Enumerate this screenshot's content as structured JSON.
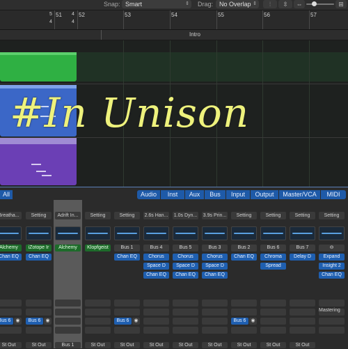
{
  "toolbar": {
    "snap_label": "Snap:",
    "snap_value": "Smart",
    "drag_label": "Drag:",
    "drag_value": "No Overlap"
  },
  "ruler": {
    "bars": [
      "51",
      "52",
      "53",
      "54",
      "55",
      "56",
      "57"
    ],
    "sig_top_a": "5",
    "sig_bottom_a": "4",
    "sig_top_b": "4",
    "sig_bottom_b": "4"
  },
  "markers": {
    "intro": "Intro"
  },
  "overlay_text": "#In Unison",
  "mixer": {
    "filters": [
      "All",
      "Audio",
      "Inst",
      "Aux",
      "Bus",
      "Input",
      "Output",
      "Master/VCA",
      "MIDI"
    ],
    "strips": [
      {
        "name": "Breatha...",
        "plug1": "Alchemy",
        "plug1_color": "green",
        "plug2": "Chan EQ",
        "send": "Bus 6",
        "out": "St Out"
      },
      {
        "name": "Setting",
        "plug1": "iZotope Ir",
        "plug1_color": "green",
        "plug2": "Chan EQ",
        "send": "Bus 6",
        "out": "St Out"
      },
      {
        "name": "Adrift In...",
        "plug1": "Alchemy",
        "plug1_color": "green",
        "plug2": "",
        "send": "",
        "out": "Bus 1"
      },
      {
        "name": "Setting",
        "plug1": "Klopfgeist",
        "plug1_color": "green",
        "plug2": "",
        "send": "",
        "out": "St Out"
      },
      {
        "name": "Setting",
        "plug1": "Bus 1",
        "plug1_color": "link",
        "plug2": "Chan EQ",
        "send": "Bus 6",
        "out": "St Out"
      },
      {
        "name": "2.6s Han...",
        "plug1": "Bus 4",
        "plug1_color": "link",
        "plug2": "Chorus",
        "plug3": "Space D",
        "plug4": "Chan EQ",
        "send": "",
        "out": "St Out"
      },
      {
        "name": "1.0s Dyn...",
        "plug1": "Bus 5",
        "plug1_color": "link",
        "plug2": "Chorus",
        "plug3": "Space D",
        "plug4": "Chan EQ",
        "send": "",
        "out": "St Out"
      },
      {
        "name": "3.9s Prin...",
        "plug1": "Bus 3",
        "plug1_color": "link",
        "plug2": "Chorus",
        "plug3": "Space D",
        "plug4": "Chan EQ",
        "send": "",
        "out": "St Out"
      },
      {
        "name": "Setting",
        "plug1": "Bus 2",
        "plug1_color": "link",
        "plug2": "Chan EQ",
        "send": "Bus 6",
        "out": "St Out"
      },
      {
        "name": "Setting",
        "plug1": "Bus 6",
        "plug1_color": "link",
        "plug2": "Chroma",
        "plug3": "Spread",
        "send": "",
        "out": "St Out"
      },
      {
        "name": "Setting",
        "plug1": "Bus 7",
        "plug1_color": "link",
        "plug2": "Delay D",
        "send": "",
        "out": "St Out"
      },
      {
        "name": "Setting",
        "plug1": "",
        "plug1_color": "link",
        "plug2": "Expand",
        "plug3": "Insight 2",
        "plug4": "Chan EQ",
        "send": "",
        "out": ""
      }
    ],
    "mastering_label": "Mastering"
  },
  "colors": {
    "green_region": "#2fb043",
    "blue_region": "#3b67c7",
    "purple_region": "#6b3fb5",
    "accent": "#1e5aa8",
    "overlay": "#eef27c"
  }
}
